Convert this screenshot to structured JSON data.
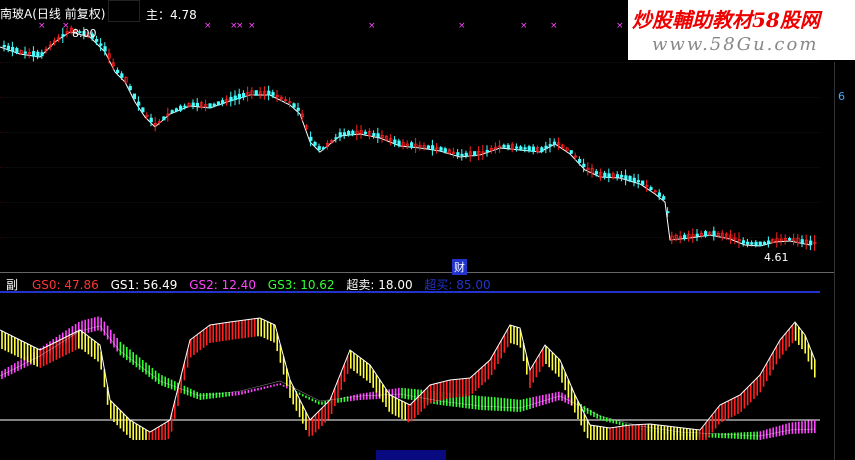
{
  "header": {
    "stock_title": "南玻A(日线 前复权)",
    "main_indicator": "主：4.78"
  },
  "price_panel": {
    "high_label": "8.00",
    "low_label": "4.61",
    "finance_tag": "财",
    "right_scale": "6"
  },
  "sub_panel": {
    "label": "副",
    "legend": [
      {
        "text": "GS0: 47.86",
        "color": "#ff3333"
      },
      {
        "text": "GS1: 56.49",
        "color": "#ffffff"
      },
      {
        "text": "GS2: 12.40",
        "color": "#ff44ff"
      },
      {
        "text": "GS3: 10.62",
        "color": "#33ff33"
      },
      {
        "text": "超卖: 18.00",
        "color": "#ffffff"
      },
      {
        "text": "超买: 85.00",
        "color": "#2233cc"
      }
    ]
  },
  "watermark": {
    "line1": "炒股輔助教材58股网",
    "line2": "www.58Gu.com"
  },
  "colors": {
    "up": "#ff2020",
    "down": "#4ff",
    "ma": "#ffffff",
    "magenta": "#ff44ff",
    "green": "#33ff33",
    "yellow": "#ffff44"
  }
}
